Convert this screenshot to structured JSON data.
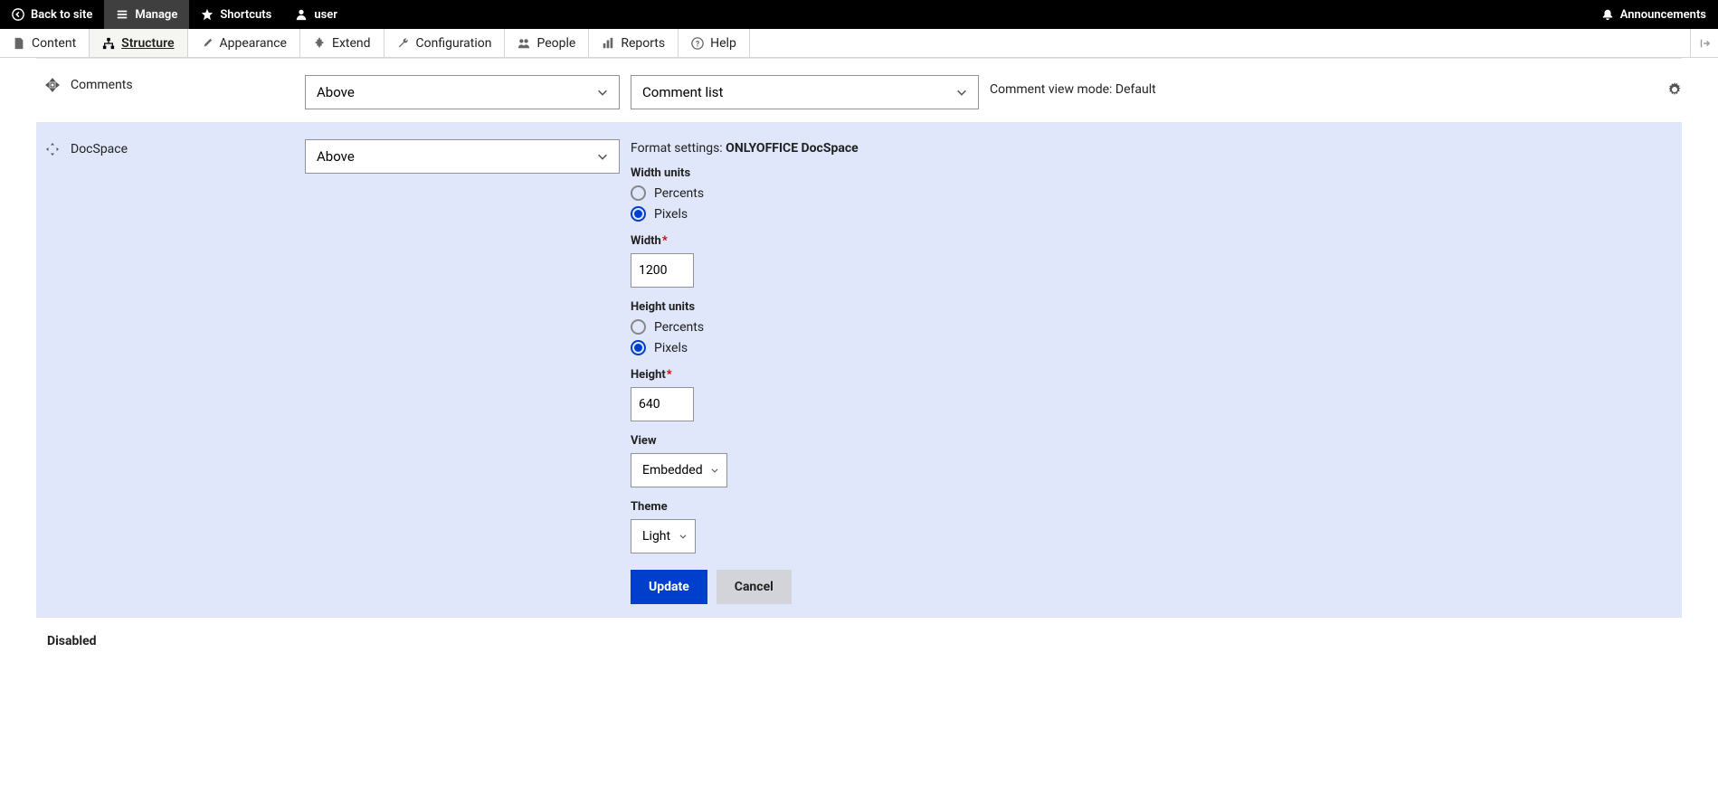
{
  "toolbar": {
    "back": "Back to site",
    "manage": "Manage",
    "shortcuts": "Shortcuts",
    "user": "user",
    "announcements": "Announcements"
  },
  "admin_menu": {
    "content": "Content",
    "structure": "Structure",
    "appearance": "Appearance",
    "extend": "Extend",
    "configuration": "Configuration",
    "people": "People",
    "reports": "Reports",
    "help": "Help"
  },
  "rows": {
    "comments": {
      "label": "Comments",
      "region": "Above",
      "format": "Comment list",
      "view_mode_prefix": "Comment view mode: ",
      "view_mode": "Default"
    },
    "docspace": {
      "label": "DocSpace",
      "region": "Above",
      "format_settings_prefix": "Format settings: ",
      "format_settings_value": "ONLYOFFICE DocSpace",
      "width_units_label": "Width units",
      "percents": "Percents",
      "pixels": "Pixels",
      "width_label": "Width",
      "width_value": "1200",
      "height_units_label": "Height units",
      "height_label": "Height",
      "height_value": "640",
      "view_label": "View",
      "view_value": "Embedded",
      "theme_label": "Theme",
      "theme_value": "Light",
      "update_btn": "Update",
      "cancel_btn": "Cancel"
    }
  },
  "disabled_label": "Disabled"
}
